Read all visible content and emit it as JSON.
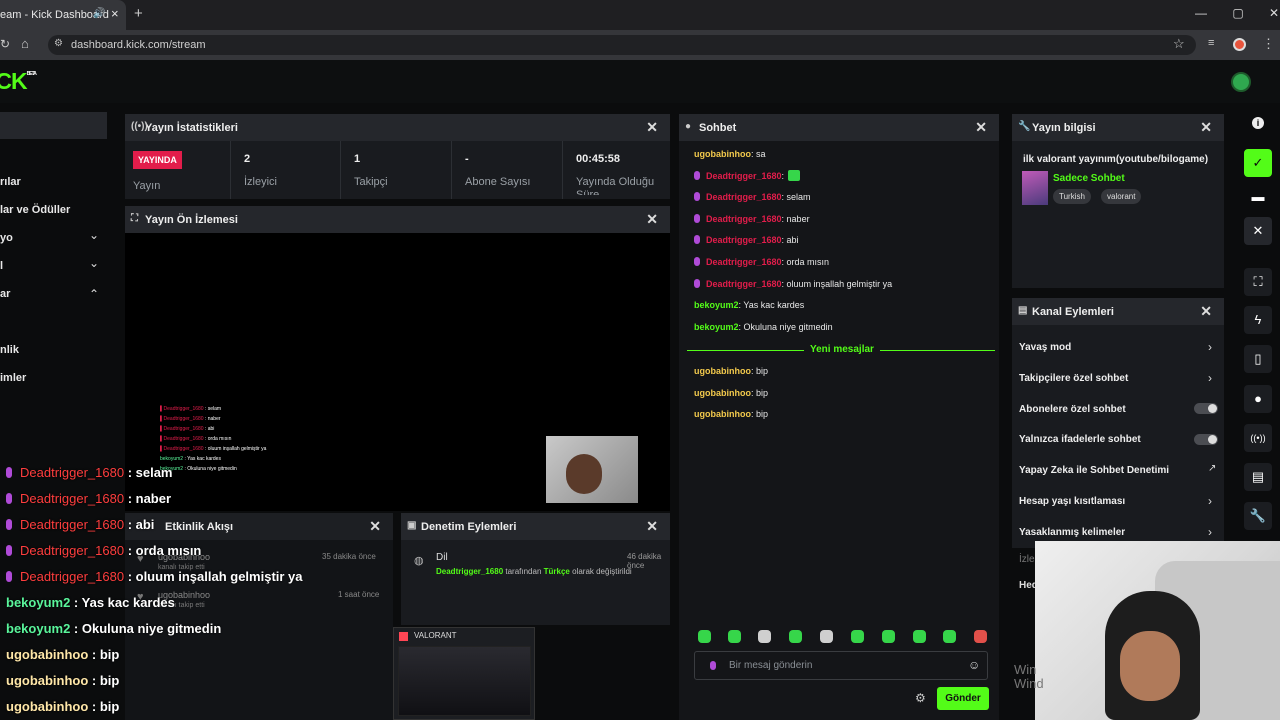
{
  "browser": {
    "tab_title": "eam - Kick Dashboard",
    "url": "dashboard.kick.com/stream"
  },
  "logo": "ICK",
  "logo_badge": "BETA",
  "sidebar": {
    "items": [
      "rılar",
      "lar ve Ödüller",
      "yo",
      "l",
      "ar",
      "nlik",
      "imler"
    ]
  },
  "stats": {
    "title": "Yayın İstatistikleri",
    "live_badge": "YAYINDA",
    "live_label": "Yayın",
    "viewers_value": "2",
    "viewers_label": "İzleyici",
    "followers_value": "1",
    "followers_label": "Takipçi",
    "subs_value": "-",
    "subs_label": "Abone Sayısı",
    "uptime_value": "00:45:58",
    "uptime_label": "Yayında Olduğu Süre"
  },
  "preview": {
    "title": "Yayın Ön İzlemesi"
  },
  "activity": {
    "title": "Etkinlik Akışı",
    "rows": [
      {
        "user": "ugobabinhoo",
        "text": "kanalı takip etti",
        "time": "35 dakika önce"
      },
      {
        "user": "ugobabinhoo",
        "text": "kanalı takip etti",
        "time": "1 saat önce"
      }
    ]
  },
  "moderation": {
    "title": "Denetim Eylemleri",
    "item_title": "Dil",
    "item_time": "46 dakika önce",
    "item_user": "Deadtrigger_1680",
    "item_mid": " tarafından ",
    "item_lang": "Türkçe",
    "item_end": " olarak değiştirildi"
  },
  "chat": {
    "title": "Sohbet",
    "separator": "Yeni mesajlar",
    "input_placeholder": "Bir mesaj gönderin",
    "send": "Gönder",
    "messages": [
      {
        "user": "ugobabinhoo",
        "text": ": sa",
        "color": "yellow",
        "mic": false
      },
      {
        "user": "Deadtrigger_1680",
        "text": ":",
        "color": "red",
        "mic": true
      },
      {
        "user": "Deadtrigger_1680",
        "text": ": selam",
        "color": "red",
        "mic": true
      },
      {
        "user": "Deadtrigger_1680",
        "text": ": naber",
        "color": "red",
        "mic": true
      },
      {
        "user": "Deadtrigger_1680",
        "text": ": abi",
        "color": "red",
        "mic": true
      },
      {
        "user": "Deadtrigger_1680",
        "text": ": orda mısın",
        "color": "red",
        "mic": true
      },
      {
        "user": "Deadtrigger_1680",
        "text": ": oluum inşallah gelmiştir ya",
        "color": "red",
        "mic": true
      },
      {
        "user": "bekoyum2",
        "text": ": Yas kac kardes",
        "color": "green",
        "mic": false
      },
      {
        "user": "bekoyum2",
        "text": ": Okuluna niye gitmedin",
        "color": "green",
        "mic": false
      }
    ],
    "new_messages": [
      {
        "user": "ugobabinhoo",
        "text": ": bip"
      },
      {
        "user": "ugobabinhoo",
        "text": ": bip"
      },
      {
        "user": "ugobabinhoo",
        "text": ": bip"
      }
    ]
  },
  "info": {
    "title": "Yayın bilgisi",
    "stream_title": "ilk valorant yayınım(youtube/bilogame)",
    "category": "Sadece Sohbet",
    "tags": [
      "Turkish",
      "valorant"
    ]
  },
  "actions": {
    "title": "Kanal Eylemleri",
    "items": [
      "Yavaş mod",
      "Takipçilere özel sohbet",
      "Abonelere özel sohbet",
      "Yalnızca ifadelerle sohbet",
      "Yapay Zeka ile Sohbet Denetimi",
      "Hesap yaşı kısıtlaması",
      "Yasaklanmış kelimeler"
    ],
    "partial1": "İzle",
    "partial2": "Hed"
  },
  "overlay": {
    "lines": [
      {
        "user": "Deadtrigger_1680",
        "text": " : selam",
        "c": "r"
      },
      {
        "user": "Deadtrigger_1680",
        "text": " : naber",
        "c": "r"
      },
      {
        "user": "Deadtrigger_1680",
        "text": " : abi",
        "c": "r"
      },
      {
        "user": "Deadtrigger_1680",
        "text": " : orda mısın",
        "c": "r"
      },
      {
        "user": "Deadtrigger_1680",
        "text": " : oluum inşallah gelmiştir ya",
        "c": "r"
      },
      {
        "user": "bekoyum2",
        "text": " : Yas kac kardes",
        "c": "g"
      },
      {
        "user": "bekoyum2",
        "text": " : Okuluna niye gitmedin",
        "c": "g"
      },
      {
        "user": "ugobabinhoo",
        "text": " : bip",
        "c": "y"
      },
      {
        "user": "ugobabinhoo",
        "text": " : bip",
        "c": "y"
      },
      {
        "user": "ugobabinhoo",
        "text": " : bip",
        "c": "y"
      }
    ]
  },
  "mini_window": {
    "title": "VALORANT"
  },
  "watermark": "Win Wind",
  "colors": {
    "kick_green": "#53fc18",
    "live_red": "#e21d4b"
  }
}
